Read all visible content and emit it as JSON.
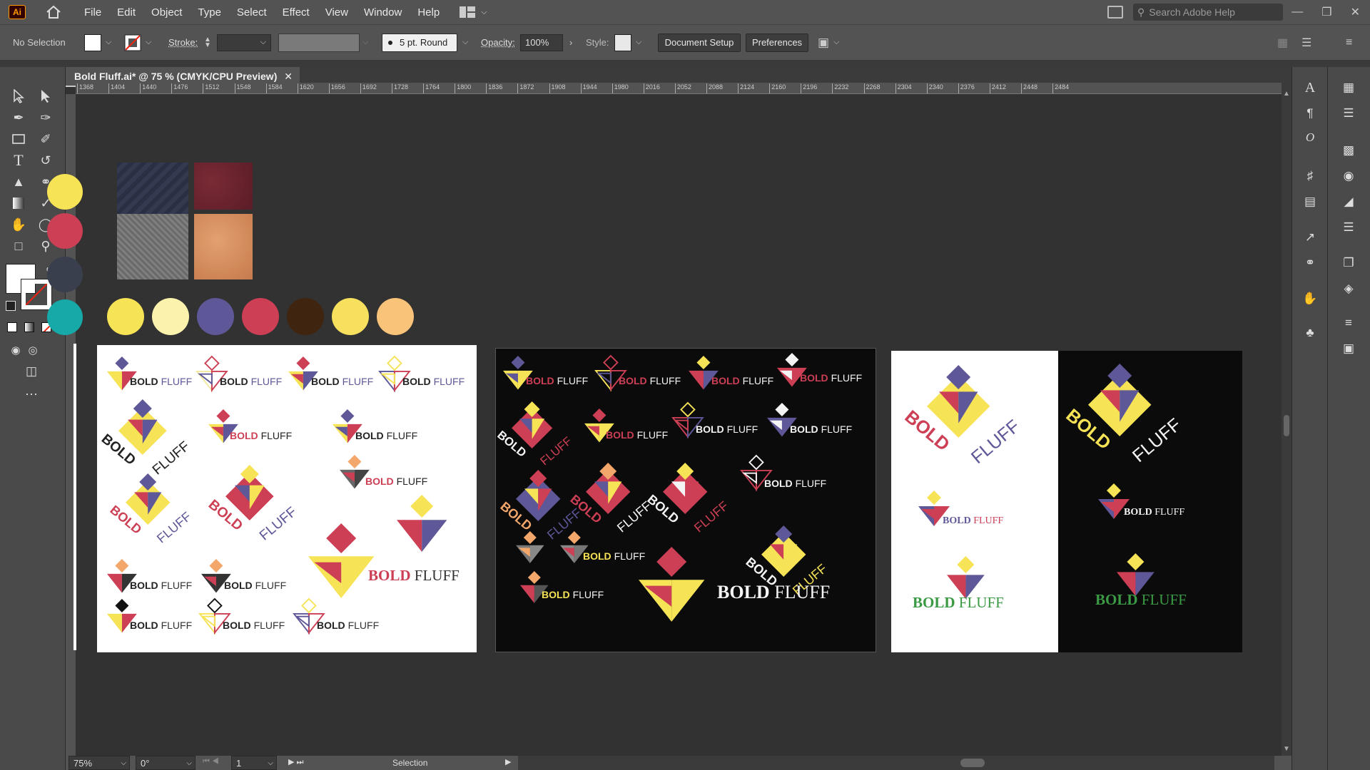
{
  "app": {
    "logo": "Ai"
  },
  "menu": [
    "File",
    "Edit",
    "Object",
    "Type",
    "Select",
    "Effect",
    "View",
    "Window",
    "Help"
  ],
  "search": {
    "placeholder": "Search Adobe Help"
  },
  "control": {
    "selection": "No Selection",
    "stroke_label": "Stroke:",
    "brush": "5 pt. Round",
    "opacity_label": "Opacity:",
    "opacity_value": "100%",
    "style_label": "Style:",
    "doc_setup": "Document Setup",
    "preferences": "Preferences"
  },
  "document": {
    "tab_title": "Bold Fluff.ai* @ 75 % (CMYK/CPU Preview)"
  },
  "ruler_ticks": [
    "1368",
    "1404",
    "1440",
    "1476",
    "1512",
    "1548",
    "1584",
    "1620",
    "1656",
    "1692",
    "1728",
    "1764",
    "1800",
    "1836",
    "1872",
    "1908",
    "1944",
    "1980",
    "2016",
    "2052",
    "2088",
    "2124",
    "2160",
    "2196",
    "2232",
    "2268",
    "2304",
    "2340",
    "2376",
    "2412",
    "2448",
    "2484"
  ],
  "status": {
    "zoom": "75%",
    "rotation": "0°",
    "artboard": "1",
    "tool": "Selection"
  },
  "palette": [
    "#f6e356",
    "#fbf3ad",
    "#5e5898",
    "#cc3f55",
    "#3f2410",
    "#f7e05e",
    "#f9c37a"
  ],
  "logo_text": {
    "bold": "BOLD",
    "fluff": "FLUFF"
  },
  "colors": {
    "yellow": "#f6e356",
    "purple": "#5e5898",
    "red": "#cc3f55",
    "orange": "#f3a76b",
    "green": "#3b9a44",
    "dark": "#0b0b0b"
  }
}
